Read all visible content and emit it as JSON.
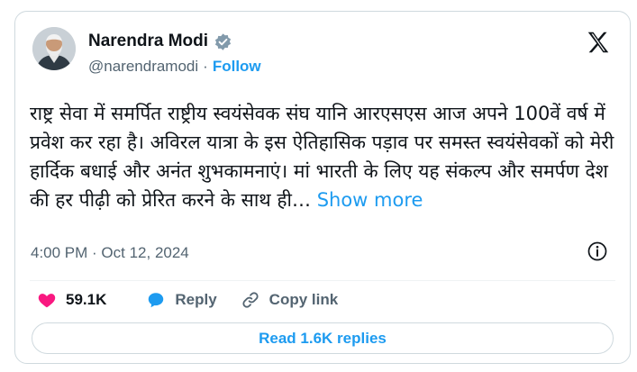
{
  "author": {
    "name": "Narendra Modi",
    "handle": "@narendramodi",
    "follow_label": "Follow",
    "verified": true
  },
  "tweet": {
    "text": "राष्ट्र सेवा में समर्पित राष्ट्रीय स्वयंसेवक संघ यानि आरएसएस आज अपने 100वें वर्ष में प्रवेश कर रहा है। अविरल यात्रा के इस ऐतिहासिक पड़ाव पर समस्त स्वयंसेवकों को मेरी हार्दिक बधाई और अनंत शुभकामनाएं। मां भारती के लिए यह संकल्प और समर्पण देश की हर पीढ़ी को प्रेरित करने के साथ ही…",
    "show_more": "Show more",
    "timestamp": "4:00 PM · Oct 12, 2024"
  },
  "actions": {
    "likes": "59.1K",
    "reply_label": "Reply",
    "copy_link_label": "Copy link"
  },
  "read_replies_label": "Read 1.6K replies",
  "colors": {
    "accent": "#1d9bf0",
    "like": "#f91880",
    "text": "#0f1419",
    "muted": "#536471",
    "border": "#cfd9de"
  },
  "icons": [
    "verified-badge-icon",
    "x-logo-icon",
    "info-icon",
    "heart-icon",
    "reply-bubble-icon",
    "link-icon"
  ]
}
